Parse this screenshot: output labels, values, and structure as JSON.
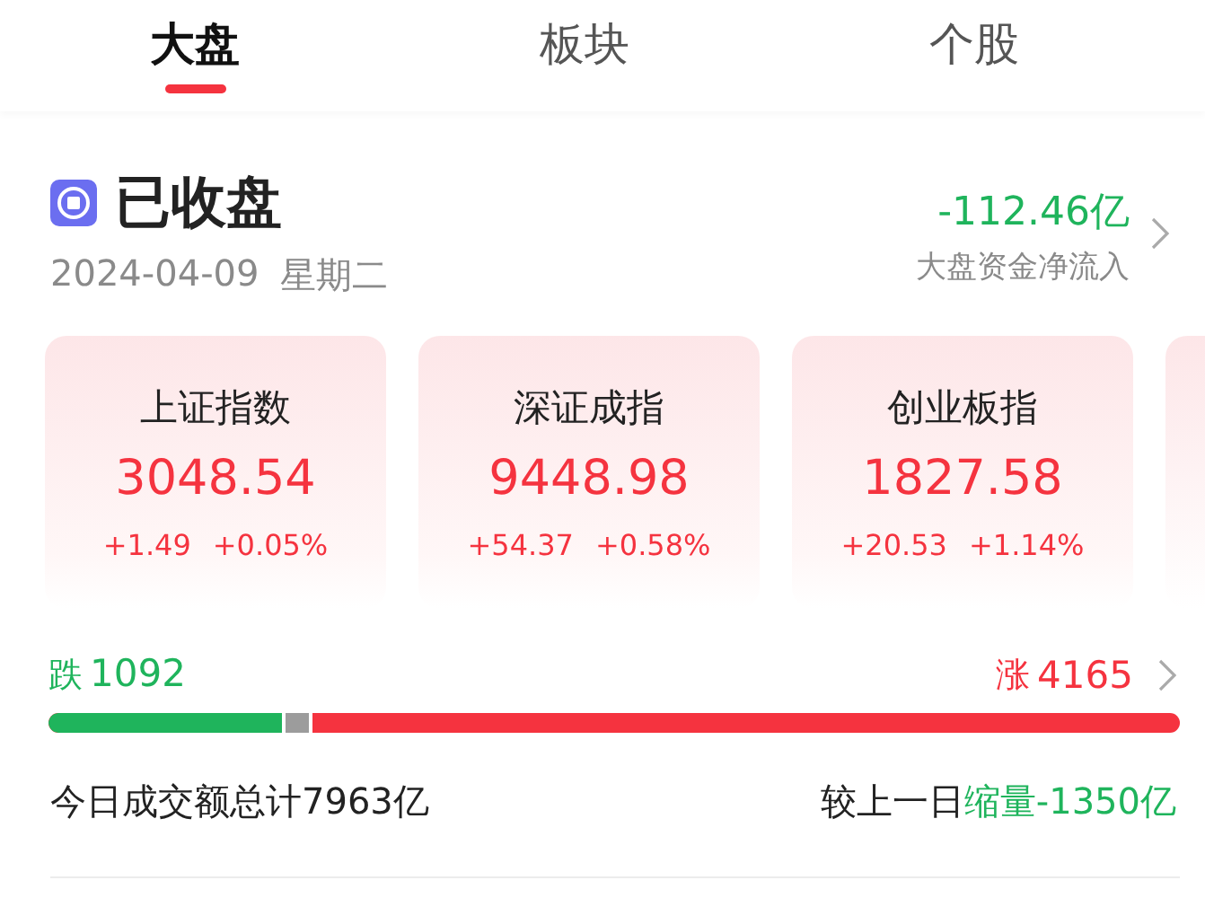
{
  "tabs": [
    {
      "label": "大盘",
      "selected": true
    },
    {
      "label": "板块",
      "selected": false
    },
    {
      "label": "个股",
      "selected": false
    }
  ],
  "status": {
    "title": "已收盘",
    "date": "2024-04-09",
    "weekday": "星期二"
  },
  "fund_flow": {
    "value": "-112.46亿",
    "label": "大盘资金净流入"
  },
  "indices": [
    {
      "name": "上证指数",
      "price": "3048.54",
      "change": "+1.49",
      "percent": "+0.05%"
    },
    {
      "name": "深证成指",
      "price": "9448.98",
      "change": "+54.37",
      "percent": "+0.58%"
    },
    {
      "name": "创业板指",
      "price": "1827.58",
      "change": "+20.53",
      "percent": "+1.14%"
    }
  ],
  "breadth": {
    "down_label": "跌",
    "down_count": "1092",
    "up_label": "涨",
    "up_count": "4165",
    "level": 0.207
  },
  "turnover": {
    "total": "今日成交额总计7963亿",
    "compare_prefix": "较上一日",
    "compare_change": "缩量-1350亿"
  }
}
